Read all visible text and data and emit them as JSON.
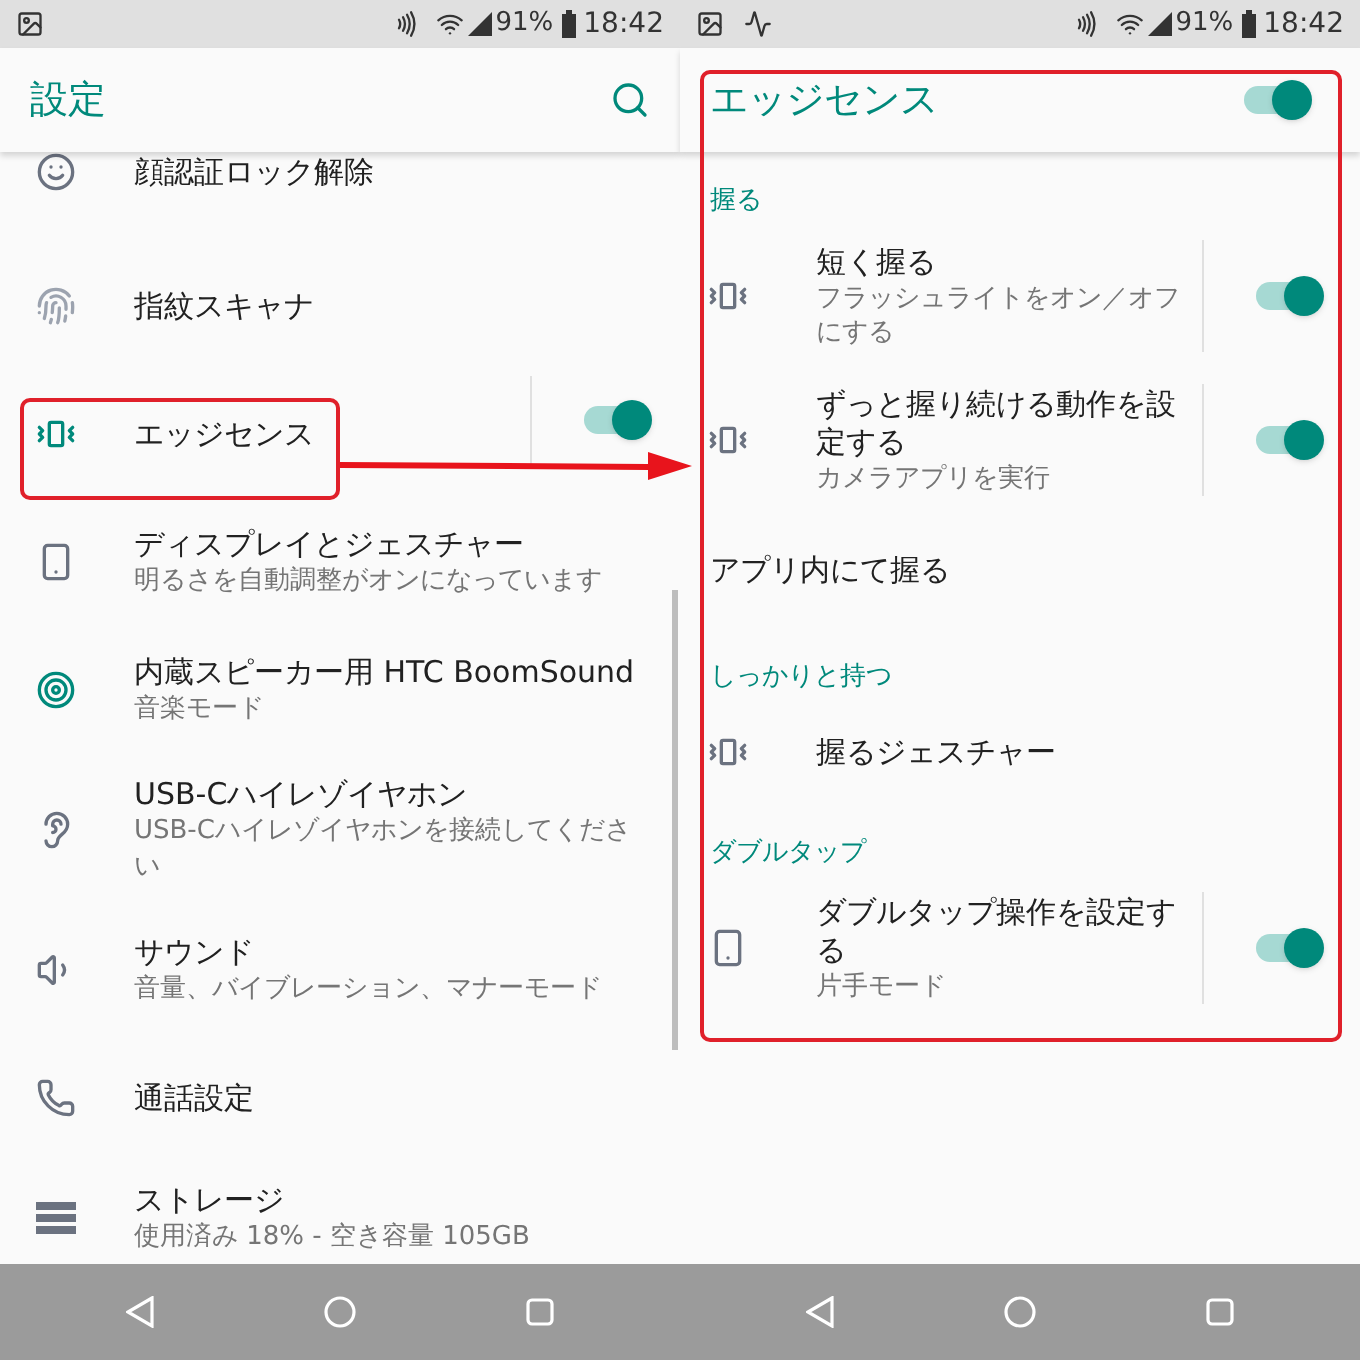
{
  "left": {
    "status_bar": {
      "battery": "91%",
      "time": "18:42"
    },
    "app_bar": {
      "title": "設定"
    },
    "items": [
      {
        "title": "顔認証ロック解除"
      },
      {
        "title": "指紋スキャナ"
      },
      {
        "title": "エッジセンス",
        "on": true
      },
      {
        "title": "ディスプレイとジェスチャー",
        "subtitle": "明るさを自動調整がオンになっています"
      },
      {
        "title": "内蔵スピーカー用 HTC BoomSound",
        "subtitle": "音楽モード"
      },
      {
        "title": "USB-Cハイレゾイヤホン",
        "subtitle": "USB-Cハイレゾイヤホンを接続してください"
      },
      {
        "title": "サウンド",
        "subtitle": "音量、バイブレーション、マナーモード"
      },
      {
        "title": "通話設定"
      },
      {
        "title": "ストレージ",
        "subtitle": "使用済み 18% - 空き容量 105GB"
      }
    ]
  },
  "right": {
    "status_bar": {
      "battery": "91%",
      "time": "18:42"
    },
    "app_bar": {
      "title": "エッジセンス",
      "on": true
    },
    "groups": [
      {
        "header": "握る",
        "items": [
          {
            "kind": "switch",
            "title": "短く握る",
            "subtitle": "フラッシュライトをオン／オフにする",
            "on": true
          },
          {
            "kind": "switch",
            "title": "ずっと握り続ける動作を設定する",
            "subtitle": "カメラアプリを実行",
            "on": true
          },
          {
            "kind": "plain",
            "title": "アプリ内にて握る"
          }
        ]
      },
      {
        "header": "しっかりと持つ",
        "items": [
          {
            "kind": "link",
            "title": "握るジェスチャー"
          }
        ]
      },
      {
        "header": "ダブルタップ",
        "items": [
          {
            "kind": "switch",
            "title": "ダブルタップ操作を設定する",
            "subtitle": "片手モード",
            "on": true
          }
        ]
      }
    ]
  }
}
